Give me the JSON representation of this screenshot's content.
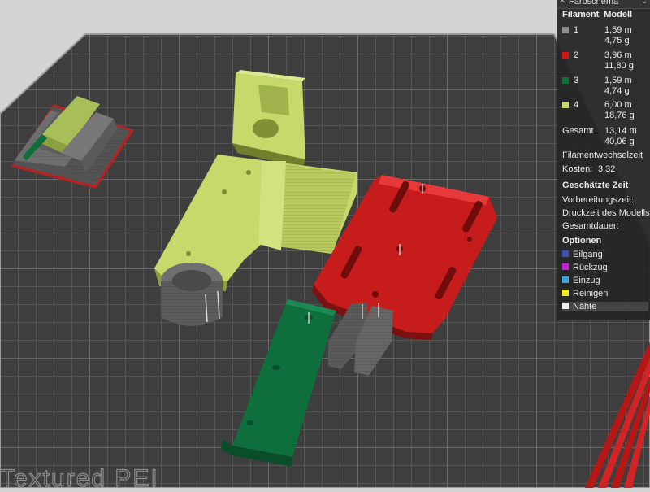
{
  "panel": {
    "title": "Farbschema",
    "header_filament": "Filament",
    "header_model": "Modell",
    "filaments": [
      {
        "id": "1",
        "color": "#8f8f8f",
        "length": "1,59 m",
        "weight": "4,75 g"
      },
      {
        "id": "2",
        "color": "#d51414",
        "length": "3,96 m",
        "weight": "11,80 g"
      },
      {
        "id": "3",
        "color": "#0e6e3c",
        "length": "1,59 m",
        "weight": "4,74 g"
      },
      {
        "id": "4",
        "color": "#c6d96a",
        "length": "6,00 m",
        "weight": "18,76 g"
      }
    ],
    "total_label": "Gesamt",
    "total_length": "13,14 m",
    "total_weight": "40,06 g",
    "filament_change": "Filamentwechselzeit",
    "cost_label": "Kosten:",
    "cost_value": "3,32",
    "time_title": "Geschätzte Zeit",
    "prep_time": "Vorbereitungszeit:",
    "print_time": "Druckzeit des Modells",
    "total_time": "Gesamtdauer:",
    "options_title": "Optionen",
    "options": [
      {
        "label": "Eilgang",
        "color": "#3d4fb5"
      },
      {
        "label": "Rückzug",
        "color": "#c21fd6"
      },
      {
        "label": "Einzug",
        "color": "#37a3d6"
      },
      {
        "label": "Reinigen",
        "color": "#f1f01b"
      },
      {
        "label": "Nähte",
        "color": "#eeeeee"
      }
    ]
  },
  "plate": {
    "label": "Textured PEI"
  }
}
